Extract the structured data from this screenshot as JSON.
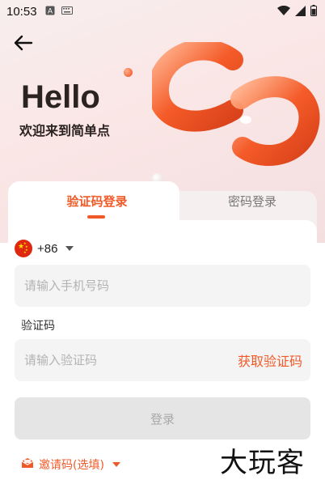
{
  "status_bar": {
    "time": "10:53"
  },
  "hero": {
    "title": "Hello",
    "subtitle": "欢迎来到简单点"
  },
  "tabs": {
    "active": "验证码登录",
    "inactive": "密码登录"
  },
  "country": {
    "dial_code": "+86"
  },
  "phone": {
    "placeholder": "请输入手机号码"
  },
  "code": {
    "label": "验证码",
    "placeholder": "请输入验证码",
    "get_code": "获取验证码"
  },
  "login_button": "登录",
  "invite": "邀请码(选填)",
  "watermark": "大玩客",
  "colors": {
    "accent": "#f05a28",
    "disabled": "#e5e5e5"
  }
}
